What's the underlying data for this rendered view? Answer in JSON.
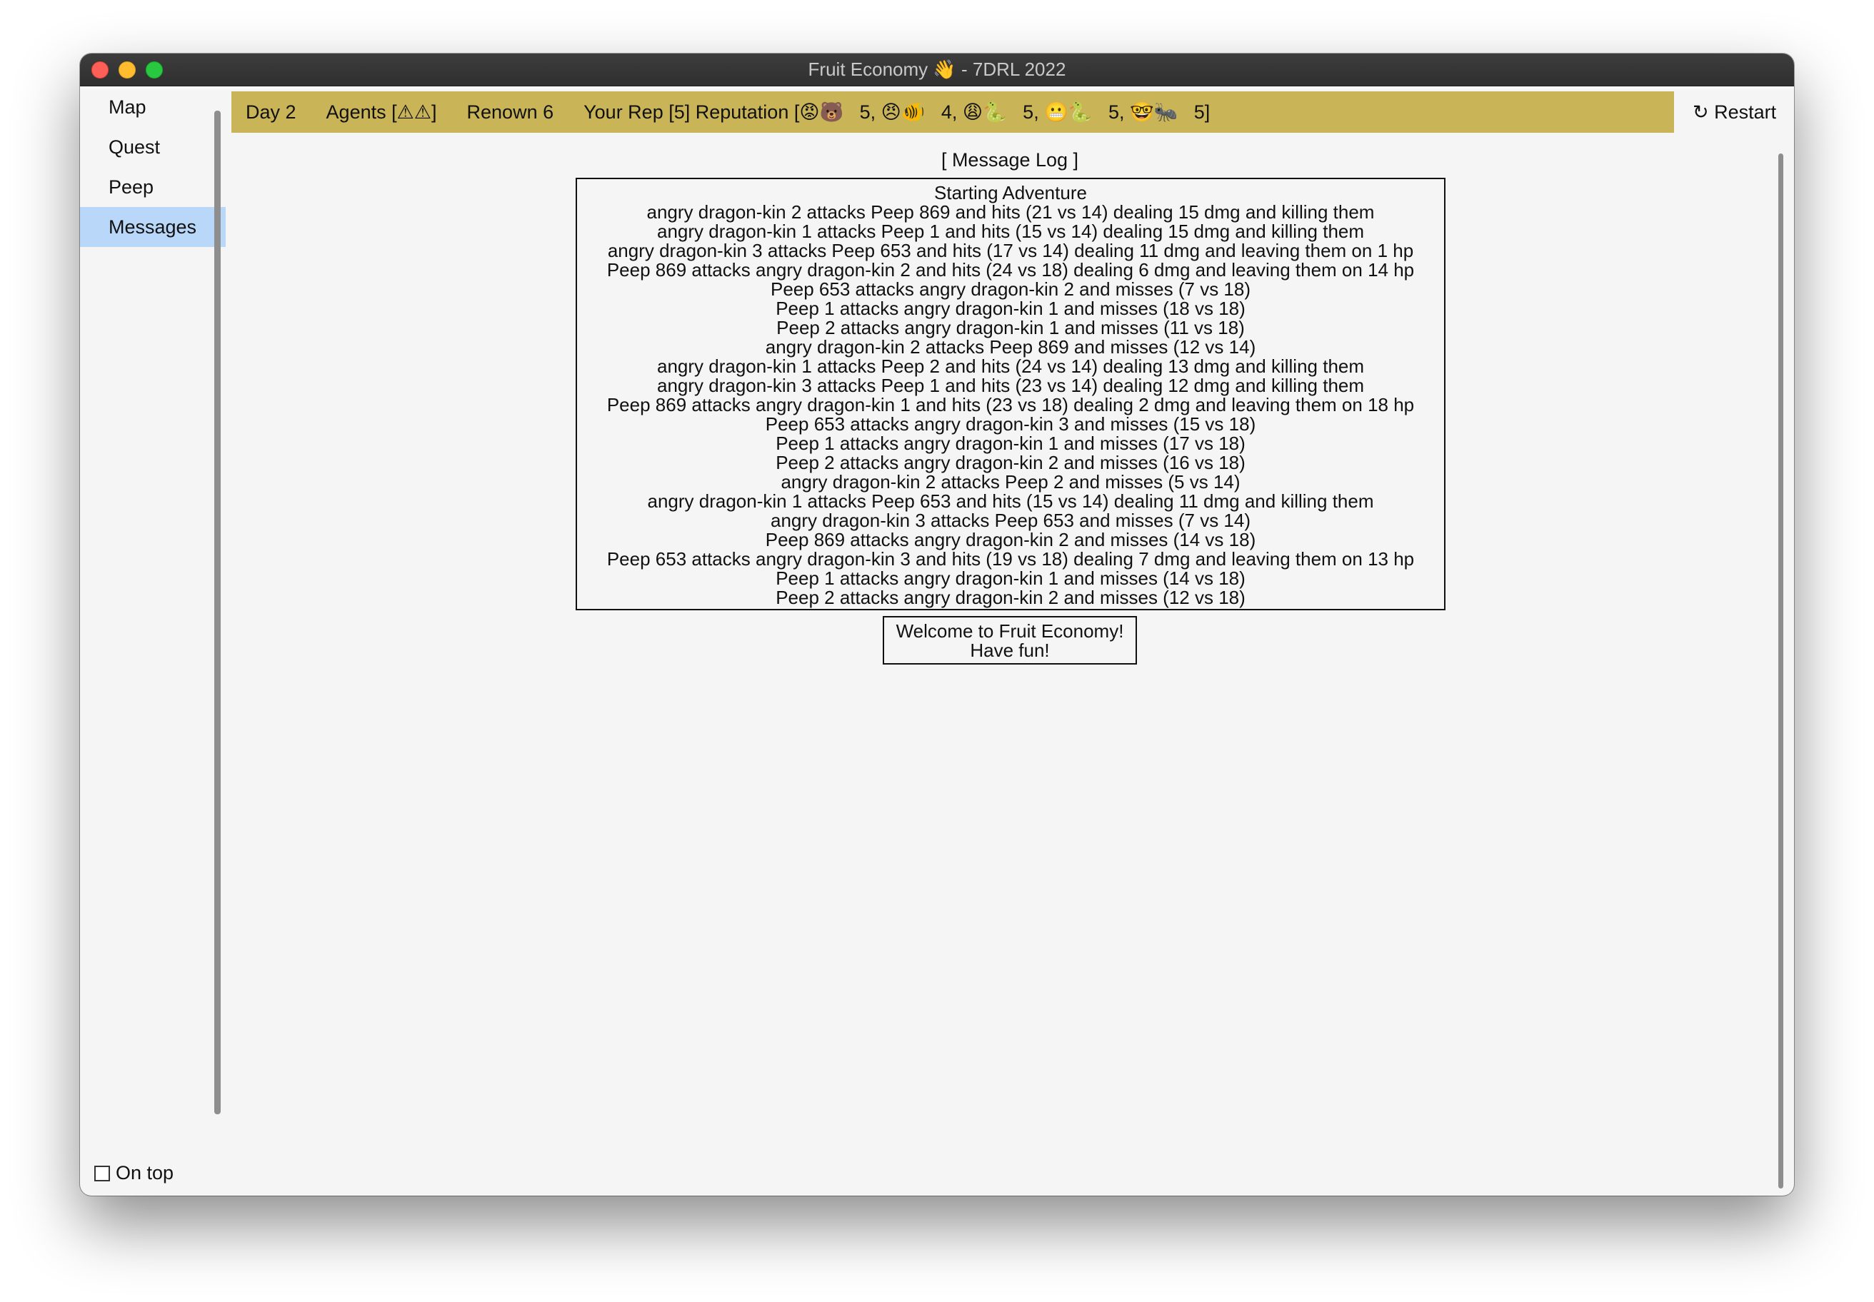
{
  "window": {
    "title": "Fruit Economy 👋 - 7DRL 2022"
  },
  "sidebar": {
    "items": [
      {
        "label": "Map"
      },
      {
        "label": "Quest"
      },
      {
        "label": "Peep"
      },
      {
        "label": "Messages"
      }
    ],
    "active": "Messages",
    "on_top_label": "On top",
    "on_top_checked": false
  },
  "status": {
    "day": "Day 2",
    "agents": "Agents [⚠⚠]",
    "renown": "Renown 6",
    "reputation": "Your Rep [5] Reputation [😡🐻   5, 😠🐠   4, 😩🐍   5, 😬🐍   5, 🤓🐜   5]"
  },
  "restart_label": "↻ Restart",
  "message_log": {
    "title": "[ Message Log ]",
    "lines": [
      "Starting Adventure",
      "angry dragon-kin 2 attacks Peep 869 and hits (21 vs 14) dealing 15 dmg and killing them",
      "angry dragon-kin 1 attacks Peep 1 and hits (15 vs 14) dealing 15 dmg and killing them",
      "angry dragon-kin 3 attacks Peep 653 and hits (17 vs 14) dealing 11 dmg and leaving them on 1 hp",
      "Peep 869 attacks angry dragon-kin 2 and hits (24 vs 18) dealing 6 dmg and leaving them on 14 hp",
      "Peep 653 attacks angry dragon-kin 2 and misses (7 vs 18)",
      "Peep 1 attacks angry dragon-kin 1 and misses (18 vs 18)",
      "Peep 2 attacks angry dragon-kin 1 and misses (11 vs 18)",
      "angry dragon-kin 2 attacks Peep 869 and misses (12 vs 14)",
      "angry dragon-kin 1 attacks Peep 2 and hits (24 vs 14) dealing 13 dmg and killing them",
      "angry dragon-kin 3 attacks Peep 1 and hits (23 vs 14) dealing 12 dmg and killing them",
      "Peep 869 attacks angry dragon-kin 1 and hits (23 vs 18) dealing 2 dmg and leaving them on 18 hp",
      "Peep 653 attacks angry dragon-kin 3 and misses (15 vs 18)",
      "Peep 1 attacks angry dragon-kin 1 and misses (17 vs 18)",
      "Peep 2 attacks angry dragon-kin 2 and misses (16 vs 18)",
      "angry dragon-kin 2 attacks Peep 2 and misses (5 vs 14)",
      "angry dragon-kin 1 attacks Peep 653 and hits (15 vs 14) dealing 11 dmg and killing them",
      "angry dragon-kin 3 attacks Peep 653 and misses (7 vs 14)",
      "Peep 869 attacks angry dragon-kin 2 and misses (14 vs 18)",
      "Peep 653 attacks angry dragon-kin 3 and hits (19 vs 18) dealing 7 dmg and leaving them on 13 hp",
      "Peep 1 attacks angry dragon-kin 1 and misses (14 vs 18)",
      "Peep 2 attacks angry dragon-kin 2 and misses (12 vs 18)"
    ]
  },
  "welcome": {
    "line1": "Welcome to Fruit Economy!",
    "line2": "Have fun!"
  },
  "colors": {
    "status_bar": "#c9b458",
    "active_nav": "#b9d7f9",
    "window_bg": "#f5f5f5"
  }
}
